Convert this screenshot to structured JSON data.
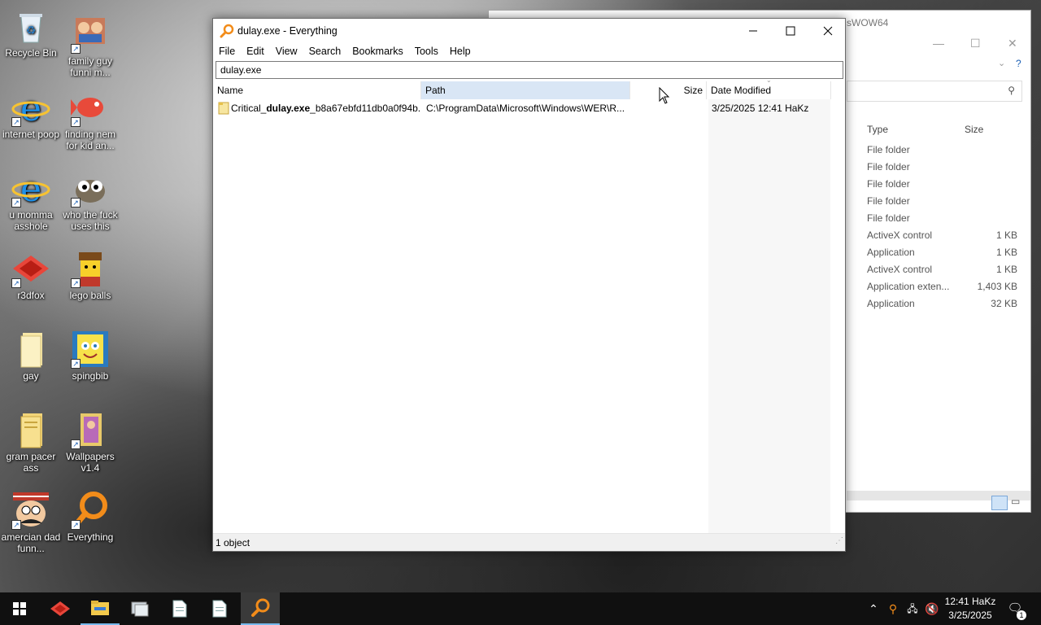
{
  "desktop": {
    "icons": [
      {
        "label": "Recycle Bin",
        "icon": "recycle-bin-icon"
      },
      {
        "label": "family guy funni m...",
        "icon": "family-guy-icon"
      },
      {
        "label": "internet poop",
        "icon": "internet-explorer-icon"
      },
      {
        "label": "finding nem for kid an...",
        "icon": "fish-icon"
      },
      {
        "label": "u momma asshole",
        "icon": "internet-explorer-icon"
      },
      {
        "label": "who the fuck uses this",
        "icon": "gimp-icon"
      },
      {
        "label": "r3dfox",
        "icon": "r3dfox-icon"
      },
      {
        "label": "lego balls",
        "icon": "lego-icon"
      },
      {
        "label": "gay",
        "icon": "folder-icon"
      },
      {
        "label": "spingbib",
        "icon": "spongebob-icon"
      },
      {
        "label": "gram pacer ass",
        "icon": "folder-icon"
      },
      {
        "label": "Wallpapers v1.4",
        "icon": "wallpapers-icon"
      },
      {
        "label": "amercian dad funn...",
        "icon": "american-dad-icon"
      },
      {
        "label": "Everything",
        "icon": "everything-icon"
      }
    ]
  },
  "background_window": {
    "title_fragment": "sWOW64",
    "columns": {
      "type": "Type",
      "size": "Size"
    },
    "rows": [
      {
        "type": "File folder",
        "size": ""
      },
      {
        "type": "File folder",
        "size": ""
      },
      {
        "type": "File folder",
        "size": ""
      },
      {
        "type": "File folder",
        "size": ""
      },
      {
        "type": "File folder",
        "size": ""
      },
      {
        "type": "ActiveX control",
        "size": "1 KB"
      },
      {
        "type": "Application",
        "size": "1 KB"
      },
      {
        "type": "ActiveX control",
        "size": "1 KB"
      },
      {
        "type": "Application exten...",
        "size": "1,403 KB"
      },
      {
        "type": "Application",
        "size": "32 KB"
      }
    ]
  },
  "main_window": {
    "title": "dulay.exe - Everything",
    "menu": [
      "File",
      "Edit",
      "View",
      "Search",
      "Bookmarks",
      "Tools",
      "Help"
    ],
    "search_value": "dulay.exe",
    "columns": {
      "name": "Name",
      "path": "Path",
      "size": "Size",
      "date": "Date Modified"
    },
    "results": [
      {
        "name_prefix": "Critical_",
        "name_match": "dulay.exe",
        "name_suffix": "_b8a67ebfd11db0a0f94b...",
        "path": "C:\\ProgramData\\Microsoft\\Windows\\WER\\R...",
        "size": "",
        "date": "3/25/2025 12:41 HaKz"
      }
    ],
    "status": "1 object"
  },
  "taskbar": {
    "apps": [
      "start-icon",
      "r3dfox-icon",
      "file-explorer-icon",
      "system-icon",
      "document-icon",
      "document-icon",
      "everything-icon"
    ],
    "clock_time": "12:41 HaKz",
    "clock_date": "3/25/2025",
    "notification_count": "1"
  },
  "colors": {
    "selected_column_header": "#d9e6f5",
    "taskbar": "#101010",
    "accent": "#76b9ed"
  }
}
